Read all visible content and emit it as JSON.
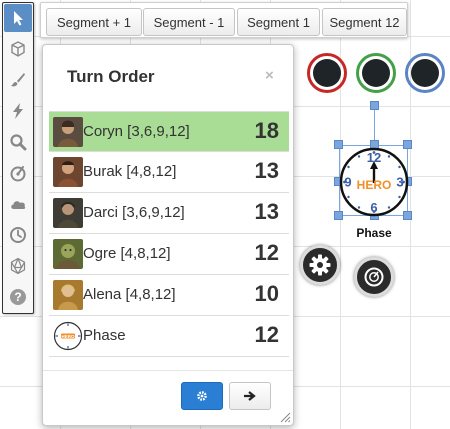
{
  "segments": {
    "plus": "Segment + 1",
    "minus": "Segment - 1",
    "seg1": "Segment 1",
    "seg12": "Segment 12"
  },
  "toolbar": {
    "tools": [
      {
        "icon": "select-arrow-icon",
        "active": true
      },
      {
        "icon": "cube-icon"
      },
      {
        "icon": "brush-icon"
      },
      {
        "icon": "lightning-icon"
      },
      {
        "icon": "magnifier-icon"
      },
      {
        "icon": "gauge-icon"
      },
      {
        "icon": "cloud-icon"
      },
      {
        "icon": "clock-icon"
      },
      {
        "icon": "d20-icon"
      },
      {
        "icon": "help-icon"
      }
    ]
  },
  "turn_order": {
    "title": "Turn Order",
    "close_glyph": "×",
    "entries": [
      {
        "name": "Coryn [3,6,9,12]",
        "initiative": "18",
        "current": true,
        "avatar_color": "#6a5a4a"
      },
      {
        "name": "Burak [4,8,12]",
        "initiative": "13",
        "avatar_color": "#7a4a36"
      },
      {
        "name": "Darci [3,6,9,12]",
        "initiative": "13",
        "avatar_color": "#4e4a3e"
      },
      {
        "name": "Ogre [4,8,12]",
        "initiative": "12",
        "avatar_color": "#6f7a3c"
      },
      {
        "name": "Alena [4,8,12]",
        "initiative": "10",
        "avatar_color": "#b98a3a"
      },
      {
        "name": "Phase",
        "initiative": "12",
        "avatar_color": "#ffffff"
      }
    ],
    "next_glyph": "➜"
  },
  "token": {
    "label": "Phase",
    "clock_word": "HERO",
    "numbers": [
      "12",
      "3",
      "6",
      "9"
    ]
  },
  "markers": [
    {
      "name": "red",
      "color": "#c62828"
    },
    {
      "name": "green",
      "color": "#43a047"
    },
    {
      "name": "blue",
      "color": "#5b84c4"
    }
  ],
  "colors": {
    "highlight": "#a9dd96",
    "primary": "#2a7fd4",
    "selection": "#7aa6dd"
  }
}
